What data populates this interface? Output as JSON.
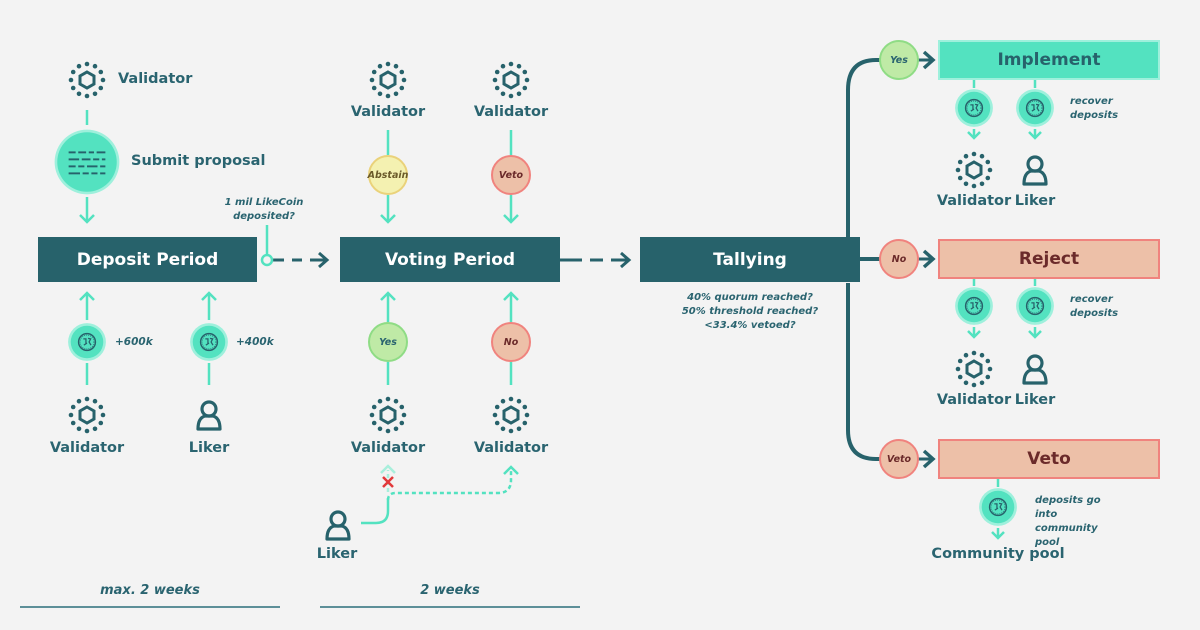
{
  "colors": {
    "background": "#f3f3f3",
    "dark_teal": "#27626b",
    "mint": "#53e2c0",
    "reject_fill": "#edc0a8",
    "reject_border": "#f0837e",
    "yes_fill": "#bfeaa6",
    "abstain_fill": "#f4f1b1",
    "cross": "#e2393b"
  },
  "deposit": {
    "proposer_label": "Validator",
    "submit_label": "Submit proposal",
    "condition_note": "1 mil LikeCoin deposited?",
    "box_label": "Deposit Period",
    "contributors": [
      {
        "role": "Validator",
        "amount": "+600k",
        "icon": "validator-icon"
      },
      {
        "role": "Liker",
        "amount": "+400k",
        "icon": "liker-icon"
      }
    ],
    "duration": "max. 2 weeks"
  },
  "voting": {
    "box_label": "Voting Period",
    "top_voters": [
      {
        "role": "Validator",
        "vote": "Abstain"
      },
      {
        "role": "Validator",
        "vote": "Veto"
      }
    ],
    "bottom_voters": [
      {
        "role": "Validator",
        "vote": "Yes"
      },
      {
        "role": "Validator",
        "vote": "No"
      }
    ],
    "delegator_label": "Liker",
    "duration": "2 weeks"
  },
  "tallying": {
    "box_label": "Tallying",
    "conditions": [
      "40% quorum reached?",
      "50% threshold reached?",
      "<33.4% vetoed?"
    ]
  },
  "outcomes": [
    {
      "key": "implement",
      "vote": "Yes",
      "label": "Implement",
      "note": "recover deposits",
      "recipients": [
        "Validator",
        "Liker"
      ]
    },
    {
      "key": "reject",
      "vote": "No",
      "label": "Reject",
      "note": "recover deposits",
      "recipients": [
        "Validator",
        "Liker"
      ]
    },
    {
      "key": "veto",
      "vote": "Veto",
      "label": "Veto",
      "note": "deposits go into community pool",
      "recipients": [
        "Community pool"
      ]
    }
  ]
}
